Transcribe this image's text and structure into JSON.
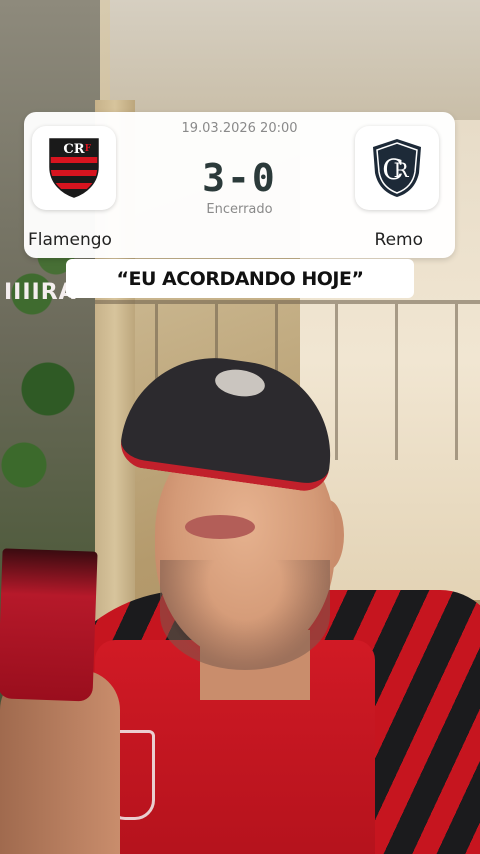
{
  "match": {
    "datetime": "19.03.2026 20:00",
    "score": "3-0",
    "status": "Encerrado",
    "home_team": "Flamengo",
    "away_team": "Remo",
    "home_logo_icon": "flamengo-crest-icon",
    "away_logo_icon": "remo-crest-icon",
    "home_colors": [
      "#1a1a1a",
      "#d7141f"
    ],
    "away_color": "#1d2a38"
  },
  "caption": {
    "text": "“EU ACORDANDO HOJE”"
  },
  "photo": {
    "cup_text": "IIIIRA"
  }
}
